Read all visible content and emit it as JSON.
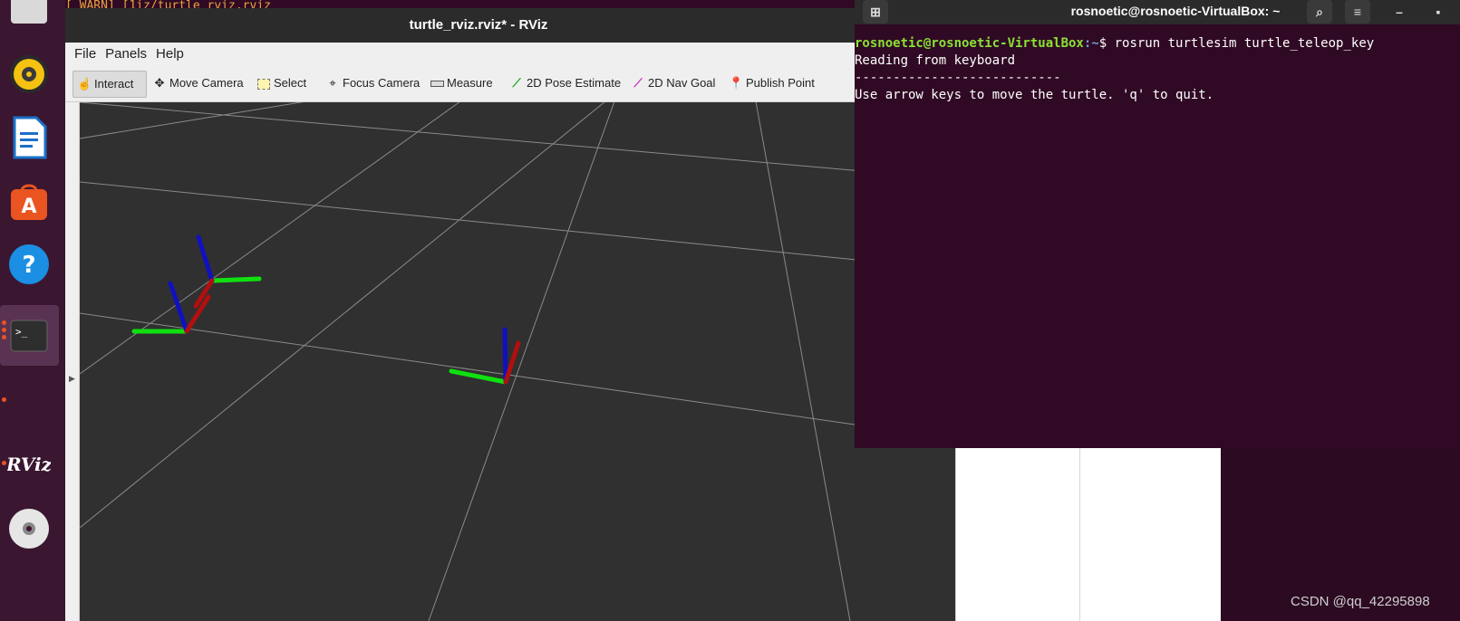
{
  "background_terminal": {
    "line": "[ WARN] [1iz/turtle_rviz.rviz"
  },
  "rviz": {
    "title": "turtle_rviz.rviz* - RViz",
    "menu": [
      "File",
      "Panels",
      "Help"
    ],
    "tools": [
      {
        "label": "Interact",
        "icon": "hand-pointer-icon"
      },
      {
        "label": "Move Camera",
        "icon": "move-camera-icon"
      },
      {
        "label": "Select",
        "icon": "select-box-icon"
      },
      {
        "label": "Focus Camera",
        "icon": "focus-camera-icon"
      },
      {
        "label": "Measure",
        "icon": "ruler-icon"
      },
      {
        "label": "2D Pose Estimate",
        "icon": "green-arrow-icon"
      },
      {
        "label": "2D Nav Goal",
        "icon": "magenta-arrow-icon"
      },
      {
        "label": "Publish Point",
        "icon": "map-pin-icon"
      }
    ],
    "active_tool": "Interact",
    "colors": {
      "axis_x": "#b01010",
      "axis_y": "#10e010",
      "axis_z": "#1010c0",
      "grid": "#8a8a8a",
      "viewport_bg": "#303030"
    }
  },
  "terminal": {
    "title": "rosnoetic@rosnoetic-VirtualBox: ~",
    "prompt_user": "rosnoetic@rosnoetic-VirtualBox",
    "prompt_path": ":~",
    "prompt_symbol": "$ ",
    "command": "rosrun turtlesim turtle_teleop_key",
    "output": [
      "Reading from keyboard",
      "---------------------------",
      "Use arrow keys to move the turtle. 'q' to quit."
    ]
  },
  "dock": [
    "files-icon",
    "rhythmbox-icon",
    "writer-icon",
    "software-center-icon",
    "help-icon",
    "terminal-icon",
    "rviz-icon",
    "dvd-icon"
  ],
  "dock_labels": {
    "rviz": "RViz"
  },
  "watermark": "CSDN @qq_42295898"
}
